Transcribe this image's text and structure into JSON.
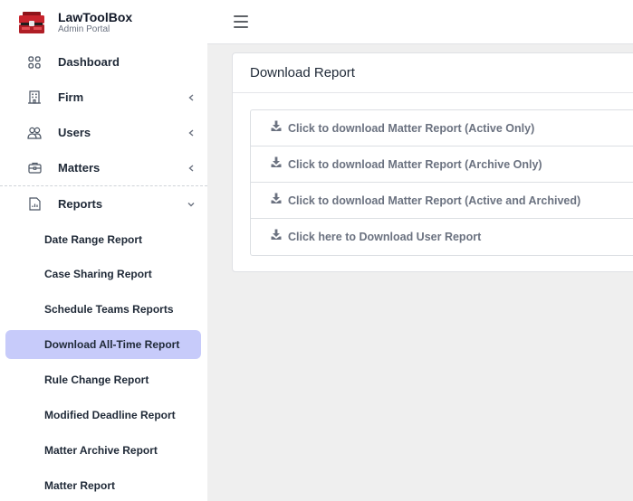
{
  "brand": {
    "name": "LawToolBox",
    "subtitle": "Admin Portal",
    "logo_color": "#c8232c"
  },
  "nav": {
    "items": [
      {
        "label": "Dashboard",
        "icon": "grid-icon",
        "chevron": ""
      },
      {
        "label": "Firm",
        "icon": "building-icon",
        "chevron": "left"
      },
      {
        "label": "Users",
        "icon": "users-icon",
        "chevron": "left"
      },
      {
        "label": "Matters",
        "icon": "briefcase-icon",
        "chevron": "left"
      },
      {
        "label": "Reports",
        "icon": "report-icon",
        "chevron": "down"
      }
    ],
    "report_subitems": [
      {
        "label": "Date Range Report",
        "active": false
      },
      {
        "label": "Case Sharing Report",
        "active": false
      },
      {
        "label": "Schedule Teams Reports",
        "active": false
      },
      {
        "label": "Download All-Time Report",
        "active": true
      },
      {
        "label": "Rule Change Report",
        "active": false
      },
      {
        "label": "Modified Deadline Report",
        "active": false
      },
      {
        "label": "Matter Archive Report",
        "active": false
      },
      {
        "label": "Matter Report",
        "active": false
      }
    ]
  },
  "header": {
    "menu_icon": "hamburger-icon"
  },
  "card": {
    "title": "Download Report",
    "links": [
      {
        "label": "Click to download Matter Report (Active Only)",
        "icon": "download-icon"
      },
      {
        "label": "Click to download Matter Report (Archive Only)",
        "icon": "download-icon"
      },
      {
        "label": "Click to download Matter Report (Active and Archived)",
        "icon": "download-icon"
      },
      {
        "label": "Click here to Download User Report",
        "icon": "download-icon"
      }
    ]
  },
  "colors": {
    "active_bg": "#c7cbfa",
    "page_bg": "#efefef",
    "link_text": "#6b7280"
  }
}
